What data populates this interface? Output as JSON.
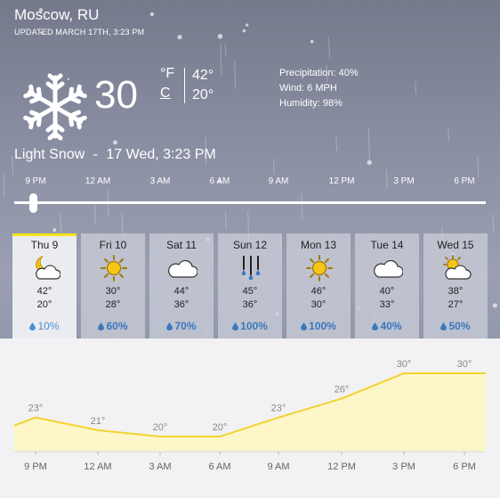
{
  "location": "Moscow, RU",
  "updated": "UPDATED MARCH 17TH, 3:23 PM",
  "current": {
    "icon": "snowflake-icon",
    "temp": "30",
    "unit_f": "°F",
    "unit_c": "C",
    "temp_f": "42°",
    "temp_c": "20°",
    "precipitation": "Precipitation: 40%",
    "wind": "Wind: 6 MPH",
    "humidity": "Humidity: 98%",
    "condition": "Light Snow",
    "separator": "-",
    "datetime": "17 Wed, 3:23 PM"
  },
  "timeline": {
    "labels": [
      "9 PM",
      "12 AM",
      "3 AM",
      "6 AM",
      "9 AM",
      "12 PM",
      "3 PM",
      "6 PM"
    ],
    "position": 0.04
  },
  "days": [
    {
      "name": "Thu 9",
      "icon": "moon-cloud-icon",
      "hi": "42°",
      "lo": "20°",
      "precip": "10%"
    },
    {
      "name": "Fri 10",
      "icon": "sun-icon",
      "hi": "30°",
      "lo": "28°",
      "precip": "60%"
    },
    {
      "name": "Sat 11",
      "icon": "cloud-icon",
      "hi": "44°",
      "lo": "36°",
      "precip": "70%"
    },
    {
      "name": "Sun 12",
      "icon": "rain-icon",
      "hi": "45°",
      "lo": "36°",
      "precip": "100%"
    },
    {
      "name": "Mon 13",
      "icon": "sun-icon",
      "hi": "46°",
      "lo": "30°",
      "precip": "100%"
    },
    {
      "name": "Tue 14",
      "icon": "cloud-icon",
      "hi": "40°",
      "lo": "33°",
      "precip": "40%"
    },
    {
      "name": "Wed 15",
      "icon": "sun-cloud-icon",
      "hi": "38°",
      "lo": "27°",
      "precip": "50%"
    }
  ],
  "colors": {
    "active_day": "#f5e21c",
    "chart_fill": "#fdf6c8",
    "chart_line": "#f4d22e",
    "precip_text": "#3a77c0"
  },
  "chart_data": {
    "type": "area",
    "categories": [
      "9 PM",
      "12 AM",
      "3 AM",
      "6 AM",
      "9 AM",
      "12 PM",
      "3 PM",
      "6 PM"
    ],
    "value_labels": [
      "23°",
      "21°",
      "20°",
      "20°",
      "23°",
      "26°",
      "30°",
      "30°"
    ],
    "values": [
      23,
      21,
      20,
      20,
      23,
      26,
      30,
      30
    ],
    "title": "",
    "xlabel": "",
    "ylabel": "",
    "ylim": [
      16,
      32
    ],
    "grid": false
  }
}
